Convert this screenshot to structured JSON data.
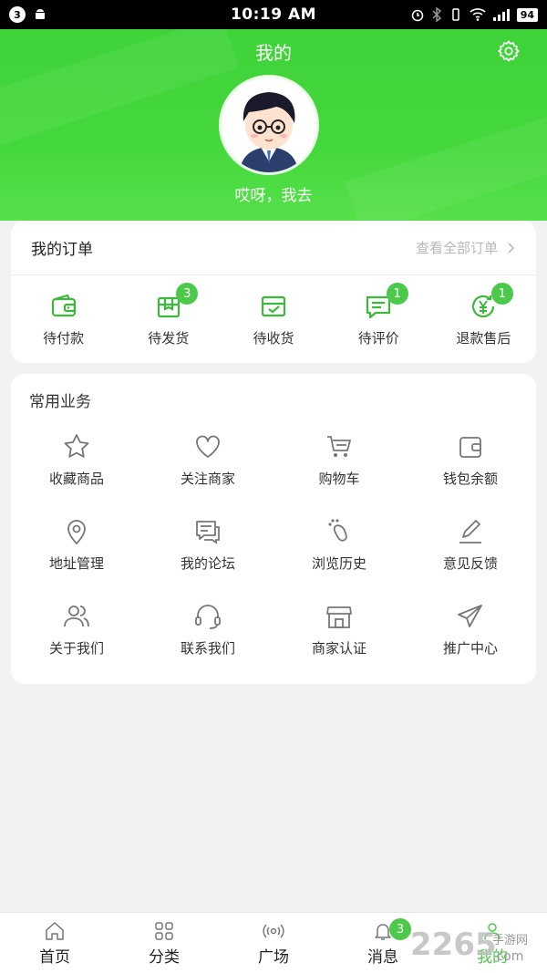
{
  "status_bar": {
    "notification_count": "3",
    "time": "10:19 AM",
    "battery": "94"
  },
  "header": {
    "title": "我的",
    "username": "哎呀，我去"
  },
  "orders": {
    "title": "我的订单",
    "view_all": "查看全部订单",
    "items": [
      {
        "label": "待付款",
        "icon": "wallet-icon",
        "badge": ""
      },
      {
        "label": "待发货",
        "icon": "package-icon",
        "badge": "3"
      },
      {
        "label": "待收货",
        "icon": "delivery-box-icon",
        "badge": ""
      },
      {
        "label": "待评价",
        "icon": "comment-icon",
        "badge": "1"
      },
      {
        "label": "退款售后",
        "icon": "yen-refund-icon",
        "badge": "1"
      }
    ]
  },
  "services": {
    "title": "常用业务",
    "items": [
      {
        "label": "收藏商品",
        "icon": "star-icon"
      },
      {
        "label": "关注商家",
        "icon": "heart-icon"
      },
      {
        "label": "购物车",
        "icon": "cart-icon"
      },
      {
        "label": "钱包余额",
        "icon": "wallet-icon"
      },
      {
        "label": "地址管理",
        "icon": "location-icon"
      },
      {
        "label": "我的论坛",
        "icon": "forum-icon"
      },
      {
        "label": "浏览历史",
        "icon": "footprint-icon"
      },
      {
        "label": "意见反馈",
        "icon": "edit-icon"
      },
      {
        "label": "关于我们",
        "icon": "users-icon"
      },
      {
        "label": "联系我们",
        "icon": "headset-icon"
      },
      {
        "label": "商家认证",
        "icon": "store-icon"
      },
      {
        "label": "推广中心",
        "icon": "send-icon"
      }
    ]
  },
  "tabbar": {
    "items": [
      {
        "label": "首页",
        "icon": "home-icon"
      },
      {
        "label": "分类",
        "icon": "grid-icon"
      },
      {
        "label": "广场",
        "icon": "broadcast-icon"
      },
      {
        "label": "消息",
        "icon": "bell-icon",
        "badge": "3"
      },
      {
        "label": "我的",
        "icon": "user-icon"
      }
    ]
  },
  "watermark": {
    "text": "2265",
    "sub": "手游网",
    "domain": ".com"
  },
  "colors": {
    "accent": "#4cc94a",
    "header_green": "#44d83c"
  }
}
